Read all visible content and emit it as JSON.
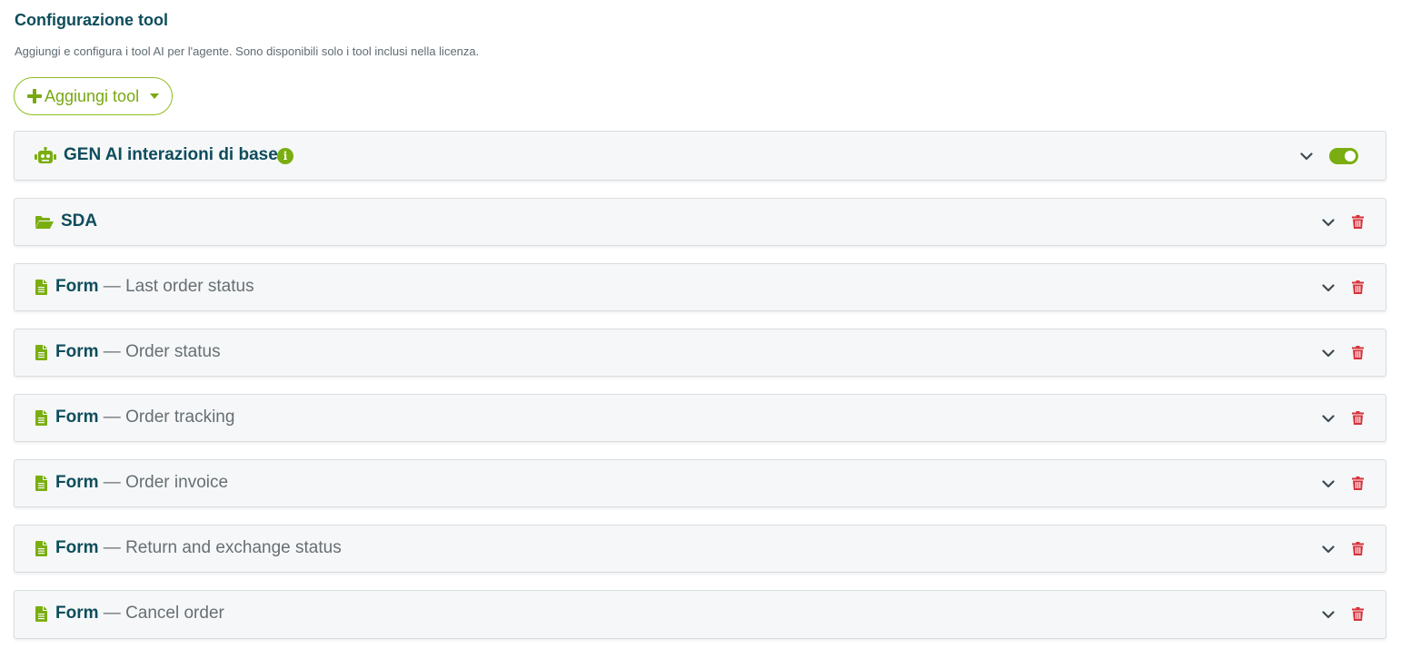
{
  "header": {
    "title": "Configurazione tool",
    "subtitle": "Aggiungi e configura i tool AI per l'agente. Sono disponibili solo i tool inclusi nella licenza."
  },
  "add_button": {
    "label": "Aggiungi tool"
  },
  "colors": {
    "accent_green": "#7aae10",
    "title_teal": "#0d4d5c",
    "delete_red": "#d6323a",
    "row_background": "#f6f7f8"
  },
  "tools": [
    {
      "icon": "robot-icon",
      "name": "GEN AI interazioni di base",
      "has_info": true,
      "control": "toggle",
      "enabled": true
    },
    {
      "icon": "folder-open-icon",
      "name": "SDA",
      "control": "delete"
    },
    {
      "icon": "file-icon",
      "name": "Form",
      "separator": "—",
      "detail": "Last order status",
      "control": "delete"
    },
    {
      "icon": "file-icon",
      "name": "Form",
      "separator": "—",
      "detail": "Order status",
      "control": "delete"
    },
    {
      "icon": "file-icon",
      "name": "Form",
      "separator": "—",
      "detail": "Order tracking",
      "control": "delete"
    },
    {
      "icon": "file-icon",
      "name": "Form",
      "separator": "—",
      "detail": "Order invoice",
      "control": "delete"
    },
    {
      "icon": "file-icon",
      "name": "Form",
      "separator": "—",
      "detail": "Return and exchange status",
      "control": "delete"
    },
    {
      "icon": "file-icon",
      "name": "Form",
      "separator": "—",
      "detail": "Cancel order",
      "control": "delete"
    }
  ]
}
